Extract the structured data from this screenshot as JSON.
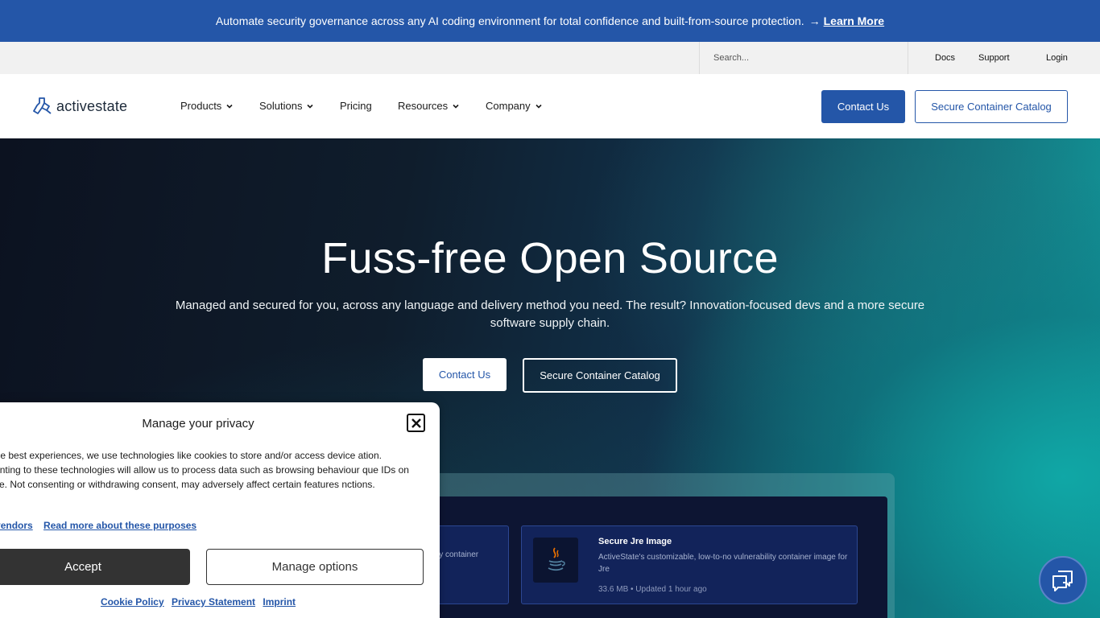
{
  "announcement": {
    "text": "Automate security governance across any AI coding environment for total confidence and built-from-source protection.",
    "arrow": "→",
    "link": "Learn More"
  },
  "utility": {
    "search_placeholder": "Search...",
    "links": [
      "Docs",
      "Support",
      "Login"
    ]
  },
  "nav": {
    "logo_text": "activestate",
    "items": [
      {
        "label": "Products",
        "dropdown": true
      },
      {
        "label": "Solutions",
        "dropdown": true
      },
      {
        "label": "Pricing",
        "dropdown": false
      },
      {
        "label": "Resources",
        "dropdown": true
      },
      {
        "label": "Company",
        "dropdown": true
      }
    ],
    "contact_label": "Contact Us",
    "catalog_label": "Secure Container Catalog"
  },
  "hero": {
    "title": "Fuss-free Open Source",
    "subtitle": "Managed and secured for you, across any language and delivery method you need. The result? Innovation-focused devs and a more secure software supply chain.",
    "contact_label": "Contact Us",
    "catalog_label": "Secure Container Catalog"
  },
  "preview": {
    "left_card_text": "lity container",
    "right_card": {
      "title": "Secure Jre Image",
      "description": "ActiveState's customizable, low-to-no vulnerability container image for Jre",
      "meta": "33.6 MB • Updated 1 hour ago",
      "icon": "java-icon"
    }
  },
  "cookie": {
    "title": "Manage your privacy",
    "body": "vide the best experiences, we use technologies like cookies to store and/or access device ation. Consenting to these technologies will allow us to process data such as browsing behaviour que IDs on this site. Not consenting or withdrawing consent, may adversely affect certain features nctions.",
    "link_vendors": "anage vendors",
    "link_purposes": "Read more about these purposes",
    "accept_label": "Accept",
    "manage_label": "Manage options",
    "footer_links": [
      "Cookie Policy",
      "Privacy Statement",
      "Imprint"
    ]
  },
  "colors": {
    "brand_blue": "#2456a8",
    "hero_teal": "#0fa5a5",
    "hero_dark": "#0c1220"
  }
}
